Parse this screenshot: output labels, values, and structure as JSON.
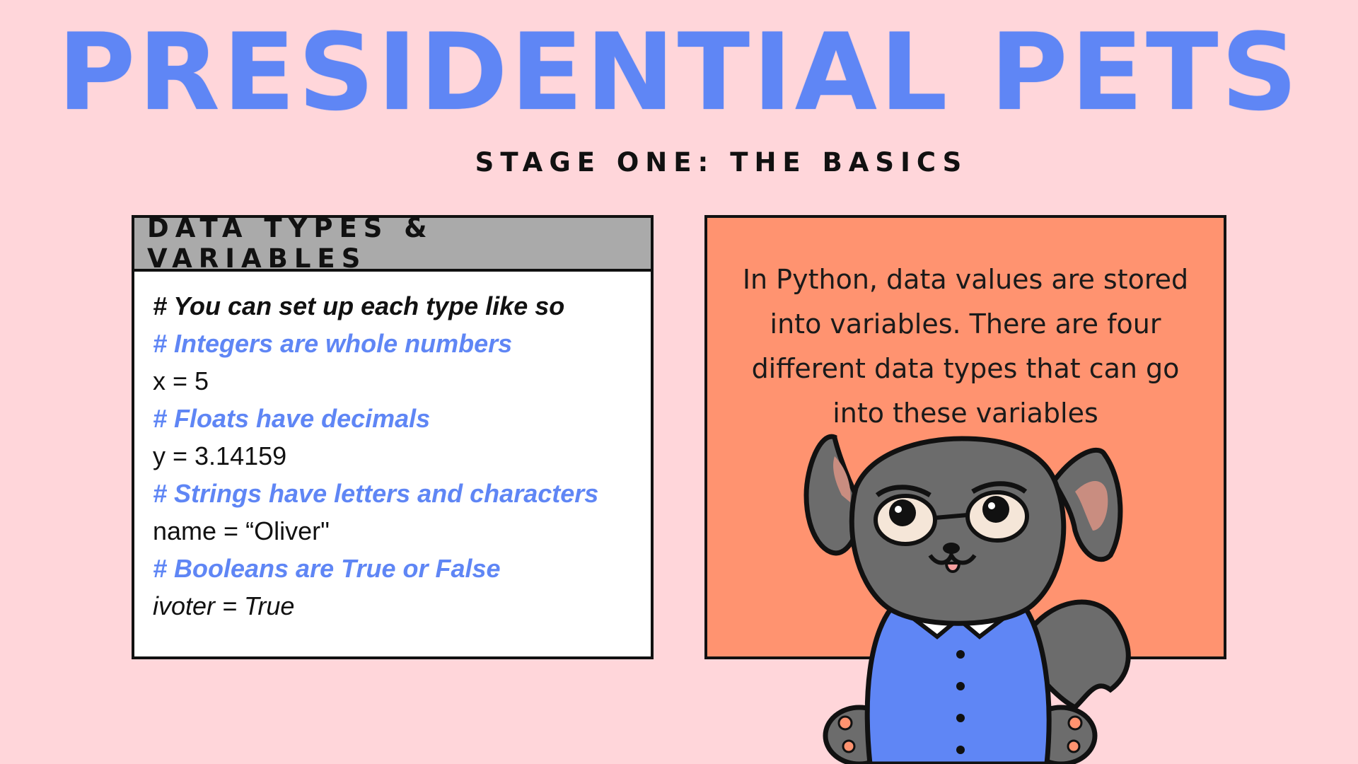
{
  "title": "PRESIDENTIAL PETS",
  "subtitle": "STAGE ONE: THE BASICS",
  "code_panel": {
    "header": "DATA TYPES & VARIABLES",
    "lines": [
      "# You can set up each type like so",
      "# Integers are whole numbers",
      "x = 5",
      "# Floats have decimals",
      "y = 3.14159",
      "# Strings have letters and characters",
      "name = “Oliver\"",
      "# Booleans are True or False",
      "ivoter = True"
    ]
  },
  "info_panel": {
    "text": "In Python, data values are stored into variables. There are four different data types that can go into these variables"
  },
  "illustration": {
    "icon": "dog-icon"
  },
  "colors": {
    "background": "#ffd6da",
    "title": "#5f86f5",
    "comment": "#5f86f5",
    "info_panel": "#ff9370",
    "header": "#aaaaaa",
    "dog_fur": "#6c6c6c",
    "dog_shirt": "#5f86f5"
  }
}
